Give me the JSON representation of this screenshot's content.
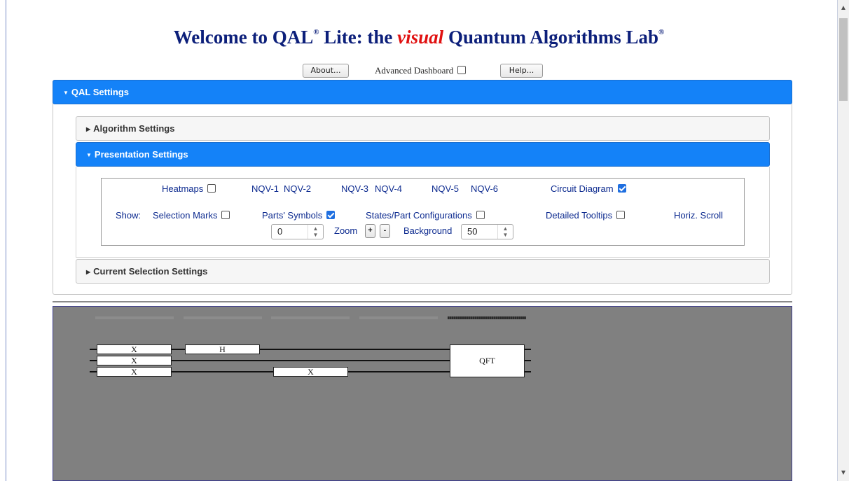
{
  "title": {
    "prefix": "Welcome to QAL",
    "reg": "®",
    "mid": " Lite: the ",
    "visual": "visual",
    "suffix": " Quantum Algorithms Lab",
    "reg2": "®"
  },
  "toolbar": {
    "about_label": "About...",
    "advanced_dashboard_label": "Advanced Dashboard",
    "advanced_dashboard_checked": false,
    "help_label": "Help..."
  },
  "panels": {
    "qal_settings": "QAL Settings",
    "algorithm_settings": "Algorithm Settings",
    "presentation_settings": "Presentation Settings",
    "current_selection_settings": "Current Selection Settings"
  },
  "presentation": {
    "heatmaps_label": "Heatmaps",
    "heatmaps_checked": false,
    "nqv": [
      "NQV-1",
      "NQV-2",
      "NQV-3",
      "NQV-4",
      "NQV-5",
      "NQV-6"
    ],
    "circuit_diagram_label": "Circuit Diagram",
    "circuit_diagram_checked": true,
    "show_label": "Show:",
    "selection_marks_label": "Selection Marks",
    "selection_marks_checked": false,
    "parts_symbols_label": "Parts' Symbols",
    "parts_symbols_checked": true,
    "states_label": "States/Part Configurations",
    "states_checked": false,
    "tooltips_label": "Detailed Tooltips",
    "tooltips_checked": false,
    "horiz_scroll_label": "Horiz. Scroll",
    "scroll_value": "0",
    "zoom_label": "Zoom",
    "zoom_plus": "+",
    "zoom_minus": "-",
    "background_label": "Background",
    "background_value": "50"
  },
  "circuit": {
    "gates": {
      "q0_x": "X",
      "q0_h": "H",
      "q1_x": "X",
      "q2_x": "X",
      "q2_x2": "X",
      "qft": "QFT"
    }
  },
  "colors": {
    "accent": "#1482f8",
    "title": "#0c1f7a",
    "visual": "#e01010",
    "canvas": "#808080"
  }
}
